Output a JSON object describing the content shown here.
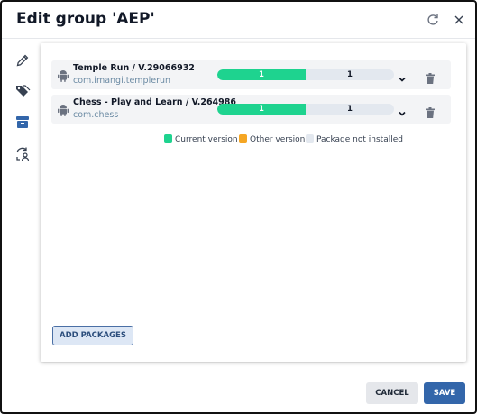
{
  "dialog": {
    "title": "Edit group 'AEP'"
  },
  "header": {
    "icons": [
      "refresh-icon",
      "close-icon"
    ]
  },
  "sidebar": {
    "items": [
      {
        "icon": "pencil-icon"
      },
      {
        "icon": "tags-icon"
      },
      {
        "icon": "archive-icon",
        "active": true
      },
      {
        "icon": "sync-user-icon"
      }
    ],
    "active_color": "#3366aa"
  },
  "packages": [
    {
      "name": "Temple Run / V.29066932",
      "id": "com.imangi.templerun",
      "current_count": "1",
      "remaining_count": "1",
      "current_fraction": 0.5
    },
    {
      "name": "Chess - Play and Learn / V.264986",
      "id": "com.chess",
      "current_count": "1",
      "remaining_count": "1",
      "current_fraction": 0.5
    }
  ],
  "legend": {
    "current": {
      "label": "Current version",
      "color": "#1ed38f"
    },
    "other": {
      "label": "Other version",
      "color": "#f5a623"
    },
    "not_installed": {
      "label": "Package not installed",
      "color": "#e3e8ef"
    }
  },
  "buttons": {
    "add_packages": "ADD PACKAGES",
    "cancel": "CANCEL",
    "save": "SAVE"
  }
}
